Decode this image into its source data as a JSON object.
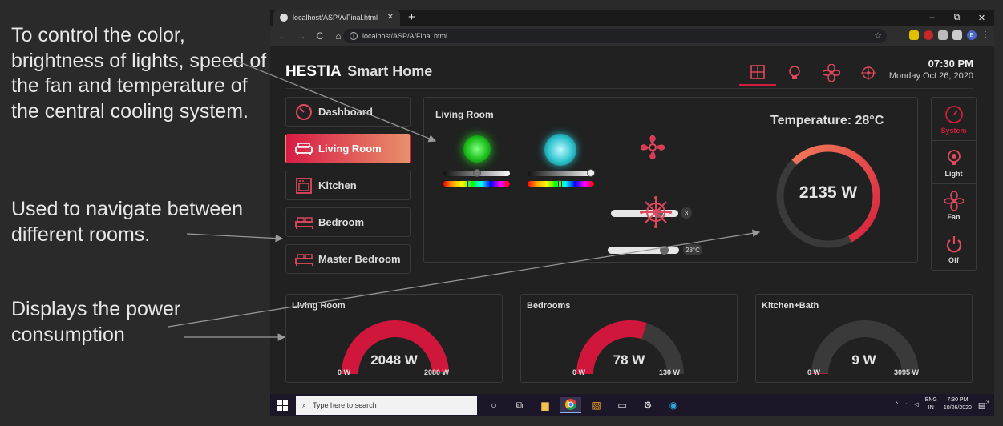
{
  "annotations": {
    "control": "To control the color, brightness of lights, speed of the fan and temperature of the central cooling system.",
    "navigate": "Used to navigate between different rooms.",
    "power": "Displays the power consumption"
  },
  "browser": {
    "tab_title": "localhost/ASP/A/Final.html",
    "tab_close": "✕",
    "new_tab": "+",
    "url": "localhost/ASP/A/Final.html",
    "back": "←",
    "forward": "→",
    "reload": "C",
    "home": "⌂",
    "minimize": "–",
    "restore": "⧉",
    "close": "✕",
    "profile": "E"
  },
  "app": {
    "brand": "HESTIA",
    "brand_sub": "Smart Home",
    "time": "07:30 PM",
    "date": "Monday Oct 26, 2020",
    "accent": "#d01e3c",
    "rooms": [
      {
        "label": "Dashboard",
        "icon": "dashboard-icon",
        "active": false
      },
      {
        "label": "Living Room",
        "icon": "sofa-icon",
        "active": true
      },
      {
        "label": "Kitchen",
        "icon": "oven-icon",
        "active": false
      },
      {
        "label": "Bedroom",
        "icon": "bed-icon",
        "active": false
      },
      {
        "label": "Master Bedroom",
        "icon": "bed-icon",
        "active": false
      }
    ],
    "control_panel": {
      "title": "Living Room",
      "fan_speed": "3",
      "ac_temp": "28°C",
      "temperature_label": "Temperature: 28°C",
      "power_value": "2135 W",
      "power_fraction": 0.55
    },
    "modes": [
      {
        "label": "System",
        "icon": "speedometer-icon",
        "active": true
      },
      {
        "label": "Light",
        "icon": "bulb-icon",
        "active": false
      },
      {
        "label": "Fan",
        "icon": "fan-icon",
        "active": false
      },
      {
        "label": "Off",
        "icon": "power-icon",
        "active": false
      }
    ],
    "power_cards": [
      {
        "title": "Living Room",
        "value": "2048 W",
        "min": "0 W",
        "max": "2080 W",
        "fraction": 0.985
      },
      {
        "title": "Bedrooms",
        "value": "78 W",
        "min": "0 W",
        "max": "130 W",
        "fraction": 0.6
      },
      {
        "title": "Kitchen+Bath",
        "value": "9 W",
        "min": "0 W",
        "max": "3095 W",
        "fraction": 0.003
      }
    ]
  },
  "taskbar": {
    "search_placeholder": "Type here to search",
    "lang": "ENG",
    "region": "IN",
    "time": "7:30 PM",
    "date": "10/26/2020",
    "notif_count": "3"
  }
}
